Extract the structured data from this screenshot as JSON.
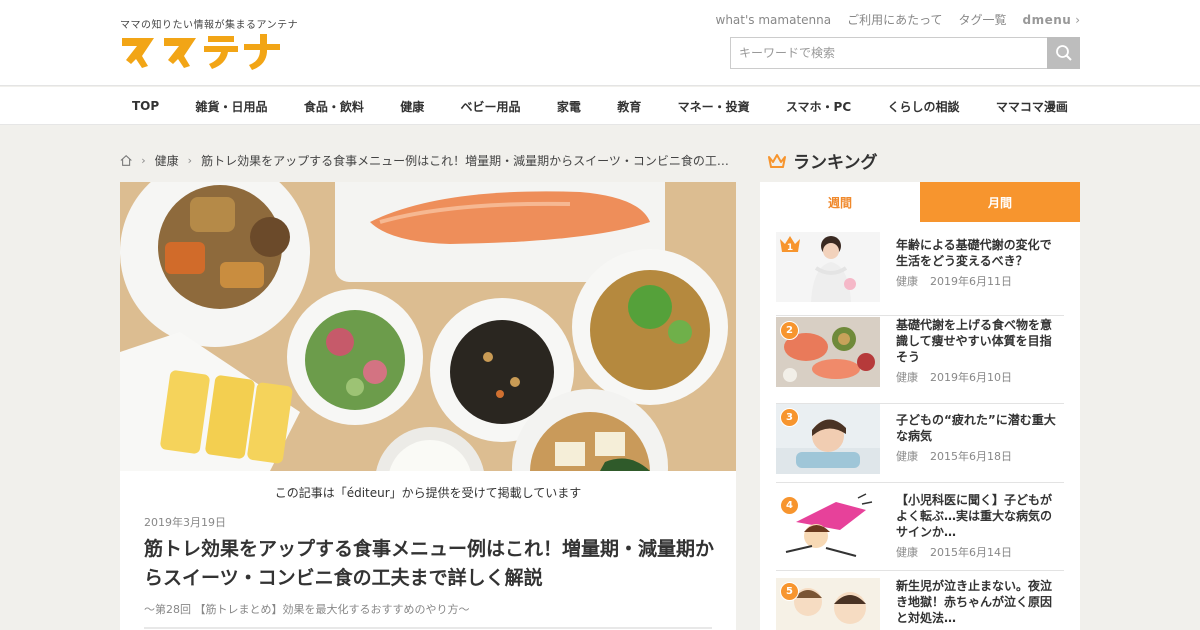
{
  "header": {
    "tagline": "ママの知りたい情報が集まるアンテナ",
    "logo_text": "ママテナ",
    "top_links": [
      "what's mamatenna",
      "ご利用にあたって",
      "タグ一覧"
    ],
    "dmenu_label": "dmenu",
    "search_placeholder": "キーワードで検索"
  },
  "nav": {
    "items": [
      "TOP",
      "雑貨・日用品",
      "食品・飲料",
      "健康",
      "ベビー用品",
      "家電",
      "教育",
      "マネー・投資",
      "スマホ・PC",
      "くらしの相談",
      "ママコマ漫画"
    ]
  },
  "breadcrumb": {
    "category": "健康",
    "current": "筋トレ効果をアップする食事メニュー例はこれ！増量期・減量期からスイーツ・コンビニ食の工夫まで詳しく解説"
  },
  "article": {
    "credit": "この記事は「éditeur」から提供を受けて掲載しています",
    "date": "2019年3月19日",
    "title": "筋トレ効果をアップする食事メニュー例はこれ！増量期・減量期からスイーツ・コンビニ食の工夫まで詳しく解説",
    "subtitle": "〜第28回 【筋トレまとめ】効果を最大化するおすすめのやり方〜"
  },
  "ranking": {
    "heading": "ランキング",
    "tab_weekly": "週間",
    "tab_monthly": "月間",
    "items": [
      {
        "rank": "1",
        "title": "年齢による基礎代謝の変化で生活をどう変えるべき？",
        "category": "健康",
        "date": "2019年6月11日"
      },
      {
        "rank": "2",
        "title": "基礎代謝を上げる食べ物を意識して痩せやすい体質を目指そう",
        "category": "健康",
        "date": "2019年6月10日"
      },
      {
        "rank": "3",
        "title": "子どもの“疲れた”に潜む重大な病気",
        "category": "健康",
        "date": "2015年6月18日"
      },
      {
        "rank": "4",
        "title": "【小児科医に聞く】子どもがよく転ぶ…実は重大な病気のサインか…",
        "category": "健康",
        "date": "2015年6月14日"
      },
      {
        "rank": "5",
        "title": "新生児が泣き止まない。夜泣き地獄！赤ちゃんが泣く原因と対処法…",
        "category": "",
        "date": ""
      }
    ]
  },
  "colors": {
    "accent_orange": "#f7952e",
    "logo_orange": "#f0a21a"
  }
}
